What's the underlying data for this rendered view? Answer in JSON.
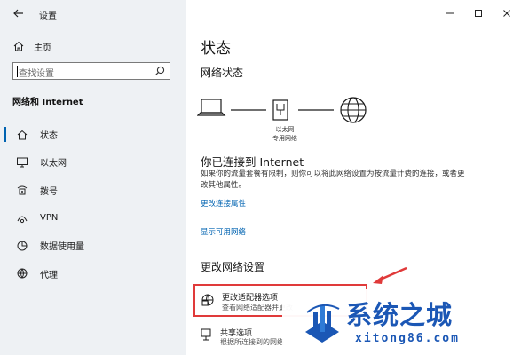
{
  "window": {
    "app_title": "设置",
    "controls": [
      "minimize-icon",
      "maximize-icon",
      "close-icon"
    ]
  },
  "sidebar": {
    "home_label": "主页",
    "search_placeholder": "查找设置",
    "section_title": "网络和 Internet",
    "items": [
      {
        "label": "状态",
        "icon": "home-status-icon",
        "active": true
      },
      {
        "label": "以太网",
        "icon": "ethernet-icon",
        "active": false
      },
      {
        "label": "拨号",
        "icon": "dialup-icon",
        "active": false
      },
      {
        "label": "VPN",
        "icon": "vpn-icon",
        "active": false
      },
      {
        "label": "数据使用量",
        "icon": "data-usage-icon",
        "active": false
      },
      {
        "label": "代理",
        "icon": "proxy-icon",
        "active": false
      }
    ]
  },
  "main": {
    "page_title": "状态",
    "network_status_heading": "网络状态",
    "diagram": {
      "ethernet_label_line1": "以太网",
      "ethernet_label_line2": "专用网络"
    },
    "connected_heading": "你已连接到 Internet",
    "description": "如果你的流量套餐有限制，则你可以将此网络设置为按流量计费的连接，或者更改其他属性。",
    "link_change_properties": "更改连接属性",
    "link_show_networks": "显示可用网络",
    "change_settings_heading": "更改网络设置",
    "adapter_option": {
      "title": "更改适配器选项",
      "desc": "查看网络适配器并更改"
    },
    "sharing_option": {
      "title": "共享选项",
      "desc": "根据所连接到的网络"
    }
  },
  "watermark": {
    "name": "系统之城",
    "url": "xitong86.com"
  },
  "colors": {
    "accent": "#0063b1",
    "highlight_border": "#e03a3a",
    "watermark": "#1b57b5"
  }
}
